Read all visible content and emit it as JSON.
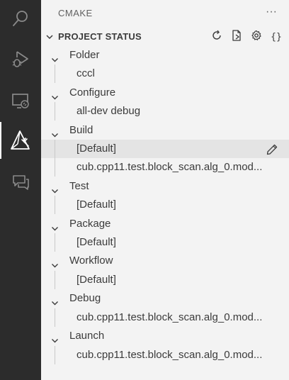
{
  "activity_bar": {
    "items": [
      {
        "name": "search-icon"
      },
      {
        "name": "run-debug-icon"
      },
      {
        "name": "remote-explorer-icon"
      },
      {
        "name": "cmake-icon",
        "active": true
      },
      {
        "name": "chat-icon"
      }
    ]
  },
  "sidebar": {
    "title": "CMAKE",
    "more_label": "···"
  },
  "section": {
    "title": "PROJECT STATUS",
    "actions": [
      {
        "name": "refresh-icon"
      },
      {
        "name": "new-file-icon"
      },
      {
        "name": "settings-gear-icon"
      },
      {
        "name": "json-braces-icon",
        "label": "{}"
      }
    ]
  },
  "tree": {
    "folder": {
      "label": "Folder",
      "child": "cccl"
    },
    "configure": {
      "label": "Configure",
      "child": "all-dev debug"
    },
    "build": {
      "label": "Build",
      "children": [
        "[Default]",
        "cub.cpp11.test.block_scan.alg_0.mod..."
      ]
    },
    "test": {
      "label": "Test",
      "child": "[Default]"
    },
    "package": {
      "label": "Package",
      "child": "[Default]"
    },
    "workflow": {
      "label": "Workflow",
      "child": "[Default]"
    },
    "debug": {
      "label": "Debug",
      "child": "cub.cpp11.test.block_scan.alg_0.mod..."
    },
    "launch": {
      "label": "Launch",
      "child": "cub.cpp11.test.block_scan.alg_0.mod..."
    }
  },
  "colors": {
    "activity_bar_bg": "#2c2c2c",
    "sidebar_bg": "#f3f3f3",
    "selected_row": "#e4e4e4",
    "text": "#3b3b3b"
  }
}
